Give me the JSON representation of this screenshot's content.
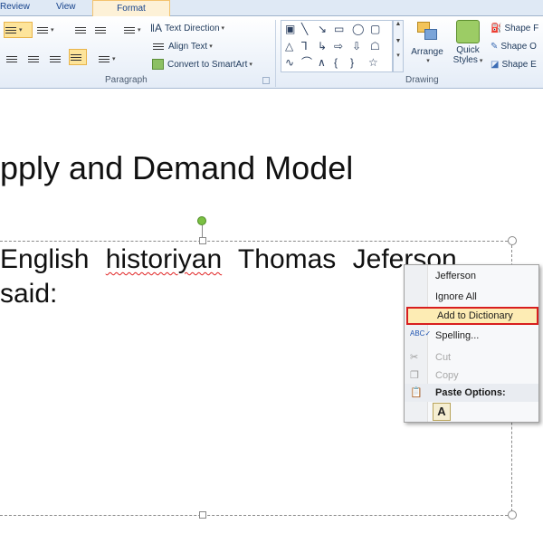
{
  "ribbon_tabs": {
    "review": "Review",
    "view": "View",
    "format": "Format"
  },
  "ribbon": {
    "paragraph_group": {
      "label": "Paragraph",
      "text_direction": "Text Direction",
      "align_text": "Align Text",
      "convert_smartart": "Convert to SmartArt"
    },
    "drawing_group": {
      "label": "Drawing",
      "arrange": "Arrange",
      "quick_styles_line1": "Quick",
      "quick_styles_line2": "Styles",
      "shape_fill": "Shape F",
      "shape_outline": "Shape O",
      "shape_effects": "Shape E"
    }
  },
  "slide": {
    "title": "pply and Demand Model",
    "body_line1_before": "English ",
    "body_misspelled": "historiyan",
    "body_line1_after": " Thomas Jeferson",
    "body_line2": "said:"
  },
  "context_menu": {
    "suggestion": "Jefferson",
    "ignore_all": "Ignore All",
    "add_to_dictionary": "Add to Dictionary",
    "spelling": "Spelling...",
    "cut": "Cut",
    "copy": "Copy",
    "paste_options": "Paste Options:",
    "paste_keep_text": "A"
  },
  "colors": {
    "highlight_border": "#d81e1e",
    "hover_fill": "#fdecb4",
    "format_tab": "#fdf1d7",
    "rotate_handle": "#7bc043"
  }
}
